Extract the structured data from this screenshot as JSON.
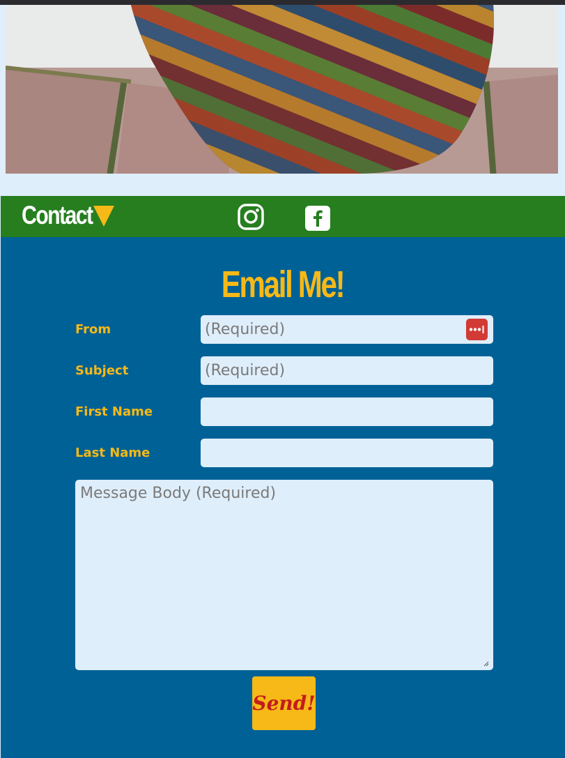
{
  "nav": {
    "title": "Contact",
    "caret_icon": "caret-down-icon",
    "social": [
      {
        "icon": "instagram-icon"
      },
      {
        "icon": "facebook-icon"
      }
    ]
  },
  "form": {
    "heading": "Email Me!",
    "from": {
      "label": "From",
      "placeholder": "(Required)",
      "value": ""
    },
    "subject": {
      "label": "Subject",
      "placeholder": "(Required)",
      "value": ""
    },
    "first_name": {
      "label": "First Name",
      "placeholder": "",
      "value": ""
    },
    "last_name": {
      "label": "Last Name",
      "placeholder": "",
      "value": ""
    },
    "message": {
      "placeholder": "Message Body (Required)",
      "value": ""
    },
    "send_label": "Send!"
  },
  "colors": {
    "nav_green": "#267e1f",
    "main_blue": "#006196",
    "accent_yellow": "#f6b917",
    "send_text_red": "#c21c1c",
    "field_bg": "#dfeefb"
  }
}
